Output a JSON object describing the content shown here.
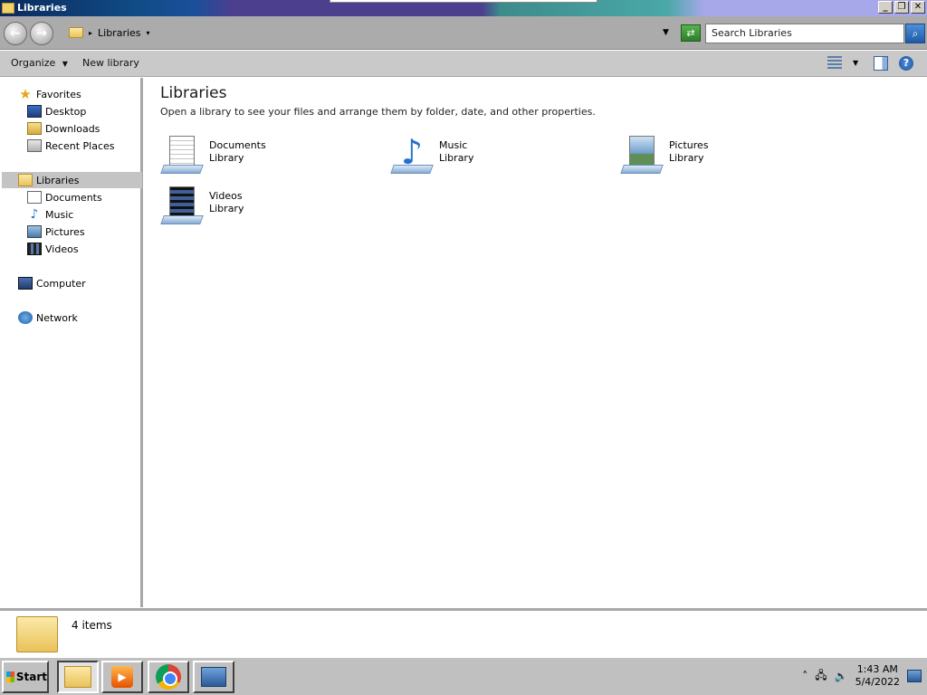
{
  "window": {
    "title": "Libraries",
    "minimize": "_",
    "maximize": "❐",
    "close": "✕"
  },
  "address": {
    "path": "Libraries",
    "search_placeholder": "Search Libraries"
  },
  "toolbar": {
    "organize": "Organize",
    "new_library": "New library"
  },
  "nav": {
    "favorites": "Favorites",
    "desktop": "Desktop",
    "downloads": "Downloads",
    "recent": "Recent Places",
    "libraries": "Libraries",
    "documents": "Documents",
    "music": "Music",
    "pictures": "Pictures",
    "videos": "Videos",
    "computer": "Computer",
    "network": "Network"
  },
  "main": {
    "title": "Libraries",
    "subtitle": "Open a library to see your files and arrange them by folder, date, and other properties.",
    "libraries": [
      {
        "name": "Documents",
        "type": "Library",
        "icon": "documents-library-icon"
      },
      {
        "name": "Music",
        "type": "Library",
        "icon": "music-library-icon"
      },
      {
        "name": "Pictures",
        "type": "Library",
        "icon": "pictures-library-icon"
      },
      {
        "name": "Videos",
        "type": "Library",
        "icon": "videos-library-icon"
      }
    ]
  },
  "status": {
    "count": "4 items"
  },
  "taskbar": {
    "start": "Start",
    "time": "1:43 AM",
    "date": "5/4/2022"
  }
}
